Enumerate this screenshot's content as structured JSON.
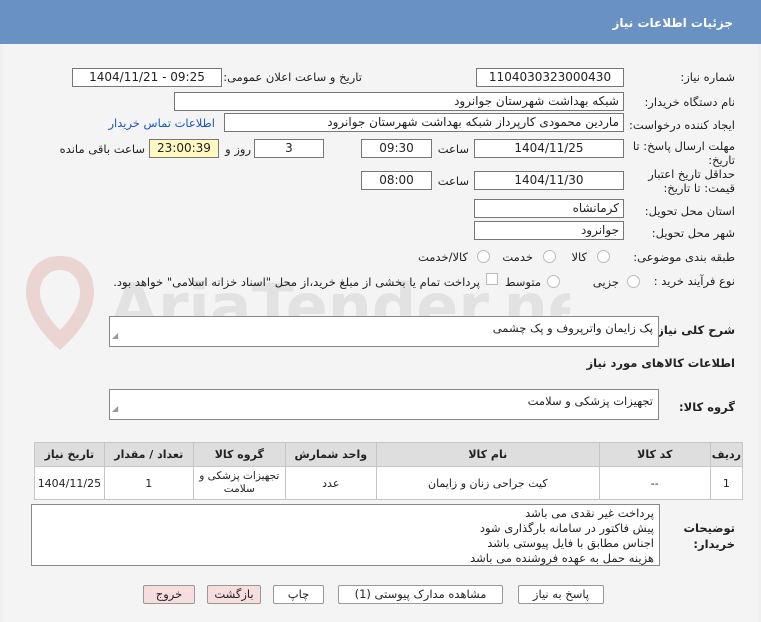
{
  "header": {
    "title": "جزئیات اطلاعات نیاز"
  },
  "form": {
    "need_number_label": "شماره نیاز:",
    "need_number": "1104030323000430",
    "announce_label": "تاریخ و ساعت اعلان عمومی:",
    "announce_value": "1404/11/21 - 09:25",
    "buyer_org_label": "نام دستگاه خریدار:",
    "buyer_org": "شبکه بهداشت شهرستان جوانرود",
    "requester_label": "ایجاد کننده درخواست:",
    "requester": "ماردین محمودی کارپرداز شبکه بهداشت شهرستان جوانرود",
    "contact_link": "اطلاعات تماس خریدار",
    "deadline_label_1": "مهلت ارسال پاسخ: تا",
    "deadline_label_2": "تاریخ:",
    "deadline_date": "1404/11/25",
    "time_label": "ساعت",
    "deadline_time": "09:30",
    "days": "3",
    "days_label": "روز و",
    "remaining_time": "23:00:39",
    "remaining_label": "ساعت باقی مانده",
    "validity_label_1": "حداقل تاریخ اعتبار",
    "validity_label_2": "قیمت: تا تاریخ:",
    "validity_date": "1404/11/30",
    "validity_time": "08:00",
    "province_label": "استان محل تحویل:",
    "province": "کرمانشاه",
    "city_label": "شهر محل تحویل:",
    "city": "جوانرود",
    "category_label": "طبقه بندی موضوعی:",
    "category_options": [
      "کالا",
      "خدمت",
      "کالا/خدمت"
    ],
    "process_label": "نوع فرآیند خرید :",
    "process_options": [
      "جزیی",
      "متوسط"
    ],
    "payment_note": "پرداخت تمام یا بخشی از مبلغ خرید،از محل \"اسناد خزانه اسلامی\" خواهد بود."
  },
  "summary": {
    "label": "شرح کلی نیاز:",
    "value": "پک زایمان واترپروف و پک چشمی"
  },
  "goods_section": {
    "title": "اطلاعات کالاهای مورد نیاز",
    "group_label": "گروه کالا:",
    "group_value": "تجهیزات پزشکی و سلامت"
  },
  "table": {
    "headers": [
      "ردیف",
      "کد کالا",
      "نام کالا",
      "واحد شمارش",
      "گروه کالا",
      "تعداد / مقدار",
      "تاریخ نیاز"
    ],
    "rows": [
      {
        "row": "1",
        "code": "--",
        "name": "کیت جراحی زنان و زایمان",
        "unit": "عدد",
        "group": "تجهیزات پزشکی و سلامت",
        "qty": "1",
        "date": "1404/11/25"
      }
    ]
  },
  "buyer_notes": {
    "label_1": "توضیحات",
    "label_2": "خریدار:",
    "lines": [
      "پرداخت غیر نقدی می باشد",
      "پیش فاکتور در سامانه بارگذاری شود",
      "اجناس مطابق با فایل پیوستی باشد",
      "هزینه حمل به عهده فروشنده می باشد"
    ]
  },
  "buttons": {
    "reply": "پاسخ به نیاز",
    "attachments": "مشاهده مدارک پیوستی (1)",
    "print": "چاپ",
    "back": "بازگشت",
    "exit": "خروج"
  },
  "watermark": {
    "text": "AriaTender.net"
  }
}
